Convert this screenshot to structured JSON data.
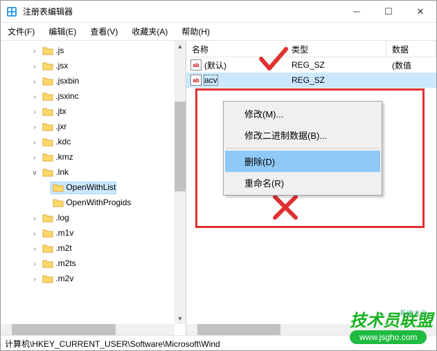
{
  "window": {
    "title": "注册表编辑器"
  },
  "menu": {
    "file": "文件(F)",
    "edit": "编辑(E)",
    "view": "查看(V)",
    "fav": "收藏夹(A)",
    "help": "帮助(H)"
  },
  "tree": {
    "items": [
      {
        "label": ".js",
        "depth": 1,
        "exp": "closed"
      },
      {
        "label": ".jsx",
        "depth": 1,
        "exp": "closed"
      },
      {
        "label": ".jsxbin",
        "depth": 1,
        "exp": "closed"
      },
      {
        "label": ".jsxinc",
        "depth": 1,
        "exp": "closed"
      },
      {
        "label": ".jtx",
        "depth": 1,
        "exp": "closed"
      },
      {
        "label": ".jxr",
        "depth": 1,
        "exp": "closed"
      },
      {
        "label": ".kdc",
        "depth": 1,
        "exp": "closed"
      },
      {
        "label": ".kmz",
        "depth": 1,
        "exp": "closed"
      },
      {
        "label": ".lnk",
        "depth": 1,
        "exp": "open"
      },
      {
        "label": "OpenWithList",
        "depth": 2,
        "exp": "none",
        "selected": true
      },
      {
        "label": "OpenWithProgids",
        "depth": 2,
        "exp": "none"
      },
      {
        "label": ".log",
        "depth": 1,
        "exp": "closed"
      },
      {
        "label": ".m1v",
        "depth": 1,
        "exp": "closed"
      },
      {
        "label": ".m2t",
        "depth": 1,
        "exp": "closed"
      },
      {
        "label": ".m2ts",
        "depth": 1,
        "exp": "closed"
      },
      {
        "label": ".m2v",
        "depth": 1,
        "exp": "closed"
      }
    ]
  },
  "list": {
    "cols": {
      "name": "名称",
      "type": "类型",
      "data": "数据"
    },
    "rows": [
      {
        "name": "(默认)",
        "type": "REG_SZ",
        "data": "(数值",
        "sel": false
      },
      {
        "name": "acv",
        "type": "REG_SZ",
        "data": "",
        "sel": true
      }
    ]
  },
  "context": {
    "modify": "修改(M)...",
    "modifyBinary": "修改二进制数据(B)...",
    "delete": "删除(D)",
    "rename": "重命名(R)"
  },
  "status": {
    "path": "计算机\\HKEY_CURRENT_USER\\Software\\Microsoft\\Wind"
  },
  "watermark": {
    "brand": "技术员联盟",
    "url": "www.jsgho.com",
    "small": "系统大全"
  }
}
